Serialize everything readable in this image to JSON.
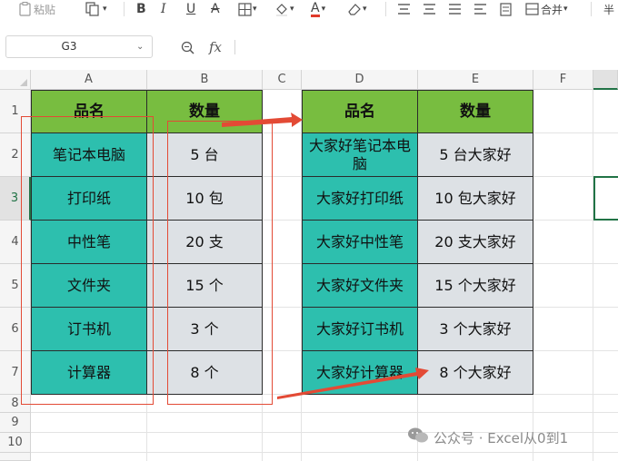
{
  "toolbar": {
    "paste_label": "粘贴",
    "merge_label": "合并",
    "more_label": "半"
  },
  "formula_bar": {
    "name_box": "G3",
    "fx_label": "fx",
    "formula": ""
  },
  "columns": [
    "A",
    "B",
    "C",
    "D",
    "E",
    "F"
  ],
  "rows": [
    "1",
    "2",
    "3",
    "4",
    "5",
    "6",
    "7",
    "8",
    "9",
    "10"
  ],
  "selected_cell": "G3",
  "colors": {
    "header_green": "#78bd40",
    "teal": "#2dbfae",
    "gray": "#dde1e5",
    "red": "#e34a35",
    "selection": "#217346"
  },
  "source_table": {
    "headers": [
      "品名",
      "数量"
    ],
    "rows": [
      [
        "笔记本电脑",
        "5 台"
      ],
      [
        "打印纸",
        "10 包"
      ],
      [
        "中性笔",
        "20 支"
      ],
      [
        "文件夹",
        "15 个"
      ],
      [
        "订书机",
        "3 个"
      ],
      [
        "计算器",
        "8 个"
      ]
    ]
  },
  "result_table": {
    "headers": [
      "品名",
      "数量"
    ],
    "rows": [
      [
        "大家好笔记本电脑",
        "5 台大家好"
      ],
      [
        "大家好打印纸",
        "10 包大家好"
      ],
      [
        "大家好中性笔",
        "20 支大家好"
      ],
      [
        "大家好文件夹",
        "15 个大家好"
      ],
      [
        "大家好订书机",
        "3 个大家好"
      ],
      [
        "大家好计算器",
        "8 个大家好"
      ]
    ]
  },
  "watermark": "公众号 · Excel从0到1"
}
